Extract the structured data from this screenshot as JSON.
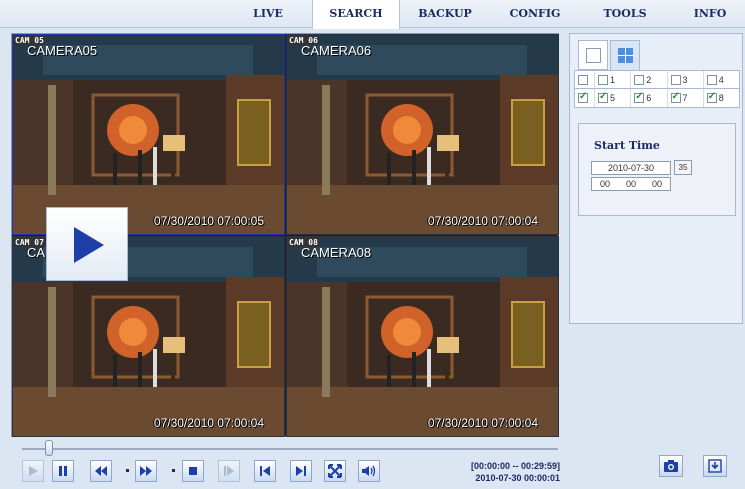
{
  "nav": {
    "tabs": [
      "LIVE",
      "SEARCH",
      "BACKUP",
      "CONFIG",
      "TOOLS",
      "INFO"
    ],
    "active": "SEARCH"
  },
  "cameras": [
    {
      "badge": "CAM 05",
      "name": "CAMERA05",
      "time": "07/30/2010 07:00:05",
      "selected": true
    },
    {
      "badge": "CAM 06",
      "name": "CAMERA06",
      "time": "07/30/2010 07:00:04",
      "selected": false
    },
    {
      "badge": "CAM 07",
      "name": "CAMERA07",
      "time": "07/30/2010 07:00:04",
      "selected": false
    },
    {
      "badge": "CAM 08",
      "name": "CAMERA08",
      "time": "07/30/2010 07:00:04",
      "selected": false
    }
  ],
  "channels": {
    "row1": [
      {
        "label": "",
        "checked": false
      },
      {
        "label": "1",
        "checked": false
      },
      {
        "label": "2",
        "checked": false
      },
      {
        "label": "3",
        "checked": false
      },
      {
        "label": "4",
        "checked": false
      }
    ],
    "row2": [
      {
        "label": "",
        "checked": true
      },
      {
        "label": "5",
        "checked": true
      },
      {
        "label": "6",
        "checked": true
      },
      {
        "label": "7",
        "checked": true
      },
      {
        "label": "8",
        "checked": true
      }
    ]
  },
  "start_time": {
    "title": "Start Time",
    "date": "2010-07-30",
    "calendar_label": "35",
    "hour": "00",
    "minute": "00",
    "second": "00"
  },
  "playback": {
    "range": "[00:00:00 -- 00:29:59]",
    "current": "2010-07-30 00:00:01",
    "seek_fraction": 0.05
  },
  "icons": {
    "play": "play-icon",
    "pause": "pause-icon",
    "rewind": "rewind-icon",
    "fast_forward": "fast-forward-icon",
    "stop": "stop-icon",
    "step": "step-icon",
    "previous": "skip-previous-icon",
    "next": "skip-next-icon",
    "fullscreen": "fullscreen-icon",
    "audio": "audio-icon",
    "snapshot": "camera-icon",
    "save": "download-icon"
  },
  "colors": {
    "accent": "#1e3ea8",
    "nav_text": "#1b2b63",
    "button_bg": "#c8daf1"
  }
}
